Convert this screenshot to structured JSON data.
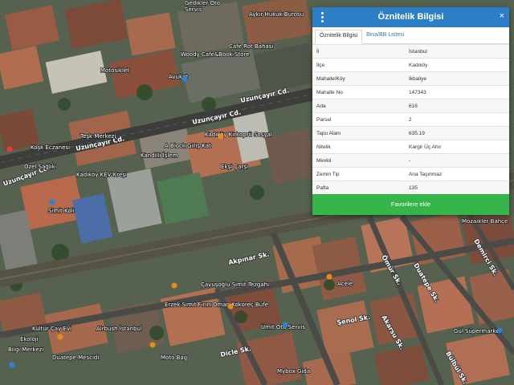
{
  "panel": {
    "title": "Öznitelik Bilgisi",
    "tabs": [
      {
        "label": "Öznitelik Bilgisi",
        "active": true
      },
      {
        "label": "Bina/BB Listesi",
        "active": false
      }
    ],
    "rows": [
      {
        "key": "İl",
        "value": "İstanbul"
      },
      {
        "key": "İlçe",
        "value": "Kadıköy"
      },
      {
        "key": "Mahalle/Köy",
        "value": "İkbaliye"
      },
      {
        "key": "Mahalle No",
        "value": "147343"
      },
      {
        "key": "Ada",
        "value": "616"
      },
      {
        "key": "Parsel",
        "value": "2"
      },
      {
        "key": "Tapu Alanı",
        "value": "635.19"
      },
      {
        "key": "Nitelik",
        "value": "Kargir Üç Ahır"
      },
      {
        "key": "Mevkii",
        "value": "-"
      },
      {
        "key": "Zemin Tip",
        "value": "Ana Taşınmaz"
      },
      {
        "key": "Pafta",
        "value": "135"
      }
    ],
    "favorite_label": "Favorilere ekle",
    "close_glyph": "×"
  },
  "map": {
    "roads": [
      "Uzunçayır Cd.",
      "Uzunçayır Cd.",
      "Uzunçayır Cd.",
      "Akpınar Sk.",
      "Şenol Sk.",
      "Bülbül Sk.",
      "Ömür Sk.",
      "Demirci Sk.",
      "Duatepe Sk.",
      "Dicle Sk.",
      "Akarsu Sk.",
      "Uzunçayır Cd."
    ],
    "places": [
      "Gedikler Oto",
      "Servis",
      "Aykır Hukuk Bürosu",
      "Cafe Rot Bahası",
      "Woody Cafe&Book Store",
      "Motosiklet",
      "Avukat",
      "Koşk Eczanesi",
      "Özel Sağlık",
      "Kadıköy Kırkoprü Sosyal",
      "Teşk Merkezi",
      "A Block Giriş Kat",
      "Kandilli İşlem",
      "Ekşi Çarşı",
      "Kadıköy KEV Kreşi",
      "Simit Koli",
      "Çavuşoğlu Simit Tezgahı",
      "Erzek Simit Fırını",
      "Oman Kokoreç Büfe",
      "Airbush İstanbul",
      "Kültür Çay Evi",
      "Ekoloji",
      "Bilgi Merkezi",
      "Ümit Oto Servis",
      "Mybox Gida",
      "Gül Süpermarket",
      "Mozaikler Bahçe",
      "Acele",
      "Duatepe Mescidi",
      "Moto Bag"
    ],
    "markers": {
      "orange": "#e88b1e",
      "blue": "#2a84d2",
      "red": "#e23b3b"
    }
  }
}
